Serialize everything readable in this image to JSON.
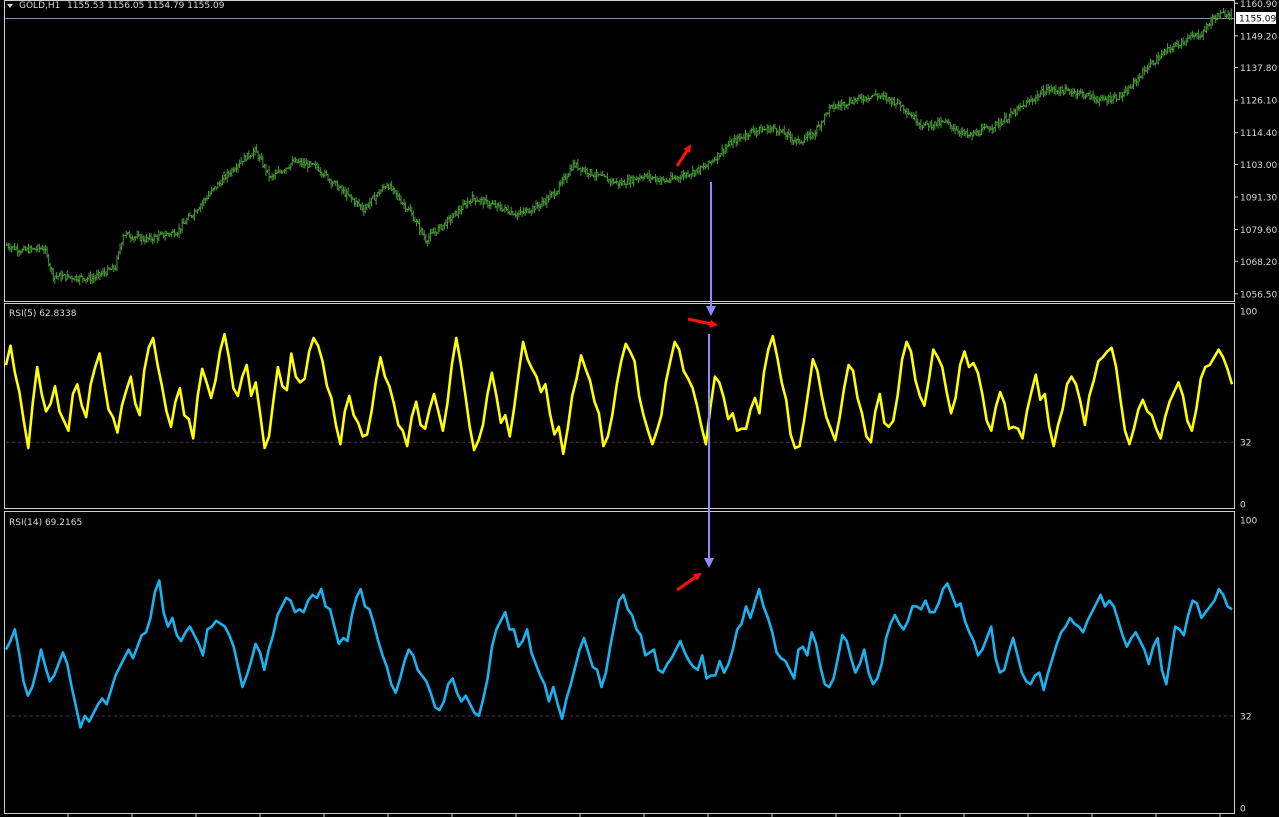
{
  "header": {
    "symbol": "GOLD,H1",
    "ohlc": "1155.53 1156.05 1154.79 1155.09",
    "dropdown_icon": "triangle-down-icon"
  },
  "colors": {
    "background": "#000000",
    "price_bars": "#4a9a3a",
    "rsi5": "#ffff00",
    "rsi14": "#19b4f0",
    "arrows_red": "#ff1010",
    "arrows_blue": "#8a8aff",
    "level_line": "#6a2a6a",
    "grid_frame": "#d0d0d0"
  },
  "chart_data": [
    {
      "type": "bar",
      "name": "price",
      "title": "GOLD,H1",
      "ylim": [
        1055.0,
        1161.0
      ],
      "yticks": [
        "1160.90",
        "1149.20",
        "1137.80",
        "1126.10",
        "1114.40",
        "1103.00",
        "1091.30",
        "1079.60",
        "1068.20",
        "1056.50"
      ],
      "last_price": "1155.09",
      "keypoints": [
        [
          0,
          1074
        ],
        [
          10,
          1072
        ],
        [
          24,
          1073
        ],
        [
          30,
          1063
        ],
        [
          55,
          1062
        ],
        [
          70,
          1066
        ],
        [
          75,
          1078
        ],
        [
          90,
          1076
        ],
        [
          110,
          1079
        ],
        [
          130,
          1092
        ],
        [
          150,
          1104
        ],
        [
          160,
          1108
        ],
        [
          170,
          1098
        ],
        [
          185,
          1104
        ],
        [
          200,
          1102
        ],
        [
          215,
          1094
        ],
        [
          230,
          1087
        ],
        [
          245,
          1096
        ],
        [
          260,
          1086
        ],
        [
          270,
          1076
        ],
        [
          285,
          1083
        ],
        [
          300,
          1091
        ],
        [
          315,
          1088
        ],
        [
          330,
          1085
        ],
        [
          345,
          1089
        ],
        [
          355,
          1094
        ],
        [
          365,
          1103
        ],
        [
          380,
          1099
        ],
        [
          395,
          1096
        ],
        [
          410,
          1099
        ],
        [
          425,
          1097
        ],
        [
          440,
          1100
        ],
        [
          450,
          1102
        ],
        [
          465,
          1110
        ],
        [
          480,
          1115
        ],
        [
          495,
          1116
        ],
        [
          510,
          1111
        ],
        [
          520,
          1114
        ],
        [
          530,
          1123
        ],
        [
          545,
          1126
        ],
        [
          560,
          1128
        ],
        [
          575,
          1125
        ],
        [
          590,
          1117
        ],
        [
          605,
          1118
        ],
        [
          620,
          1113
        ],
        [
          640,
          1118
        ],
        [
          655,
          1124
        ],
        [
          670,
          1130
        ],
        [
          690,
          1129
        ],
        [
          705,
          1126
        ],
        [
          720,
          1128
        ],
        [
          735,
          1138
        ],
        [
          748,
          1144
        ],
        [
          760,
          1148
        ],
        [
          770,
          1150
        ],
        [
          778,
          1156
        ],
        [
          790,
          1158
        ]
      ]
    },
    {
      "type": "line",
      "name": "rsi5",
      "title": "RSI(5) 62.8338",
      "ylim": [
        0,
        100
      ],
      "yticks": [
        "100",
        "32",
        "0"
      ],
      "level": 32,
      "values": [
        72,
        82,
        68,
        58,
        43,
        29,
        52,
        71,
        57,
        48,
        52,
        61,
        48,
        43,
        38,
        57,
        62,
        51,
        45,
        62,
        71,
        78,
        63,
        49,
        45,
        37,
        51,
        59,
        66,
        52,
        46,
        69,
        81,
        86,
        72,
        61,
        48,
        40,
        53,
        60,
        46,
        44,
        34,
        56,
        70,
        63,
        55,
        64,
        79,
        88,
        76,
        60,
        56,
        66,
        72,
        56,
        63,
        47,
        29,
        35,
        54,
        71,
        61,
        59,
        78,
        66,
        63,
        65,
        79,
        86,
        82,
        74,
        61,
        55,
        41,
        31,
        48,
        56,
        46,
        42,
        35,
        36,
        48,
        64,
        76,
        66,
        61,
        52,
        41,
        38,
        30,
        45,
        53,
        41,
        39,
        49,
        57,
        48,
        38,
        52,
        72,
        86,
        73,
        57,
        40,
        28,
        33,
        41,
        57,
        68,
        56,
        42,
        46,
        35,
        50,
        68,
        84,
        75,
        70,
        66,
        58,
        62,
        47,
        36,
        40,
        26,
        39,
        56,
        65,
        77,
        70,
        64,
        53,
        47,
        30,
        35,
        46,
        62,
        74,
        83,
        79,
        74,
        56,
        46,
        38,
        31,
        38,
        46,
        63,
        74,
        84,
        80,
        69,
        65,
        60,
        51,
        40,
        31,
        50,
        66,
        63,
        55,
        44,
        47,
        38,
        39,
        39,
        49,
        55,
        47,
        68,
        80,
        87,
        76,
        63,
        54,
        36,
        29,
        30,
        43,
        59,
        75,
        69,
        56,
        45,
        39,
        33,
        45,
        60,
        72,
        69,
        55,
        47,
        35,
        32,
        48,
        57,
        42,
        40,
        43,
        56,
        75,
        84,
        79,
        64,
        56,
        51,
        64,
        80,
        76,
        71,
        58,
        47,
        55,
        72,
        79,
        71,
        73,
        68,
        57,
        43,
        38,
        50,
        58,
        52,
        39,
        40,
        39,
        34,
        48,
        58,
        67,
        54,
        57,
        40,
        30,
        41,
        49,
        62,
        66,
        62,
        53,
        41,
        56,
        64,
        74,
        76,
        79,
        81,
        71,
        54,
        38,
        31,
        39,
        49,
        54,
        48,
        46,
        39,
        34,
        45,
        53,
        58,
        63,
        56,
        43,
        38,
        49,
        65,
        71,
        72,
        76,
        80,
        76,
        70,
        62
      ],
      "ticks": []
    },
    {
      "type": "line",
      "name": "rsi14",
      "title": "RSI(14) 69.2165",
      "ylim": [
        0,
        100
      ],
      "yticks": [
        "100",
        "32",
        "0"
      ],
      "level": 32,
      "values": [
        55,
        58,
        62,
        54,
        44,
        39,
        42,
        48,
        55,
        49,
        44,
        46,
        50,
        54,
        50,
        42,
        35,
        28,
        32,
        30,
        33,
        36,
        38,
        36,
        41,
        46,
        49,
        52,
        55,
        52,
        56,
        60,
        61,
        66,
        75,
        79,
        68,
        63,
        66,
        60,
        58,
        61,
        63,
        60,
        57,
        53,
        62,
        63,
        65,
        64,
        63,
        60,
        56,
        49,
        42,
        46,
        51,
        57,
        54,
        48,
        55,
        60,
        67,
        70,
        73,
        72,
        68,
        69,
        68,
        72,
        74,
        73,
        76,
        70,
        69,
        63,
        57,
        59,
        58,
        67,
        73,
        76,
        70,
        69,
        64,
        58,
        53,
        49,
        43,
        40,
        45,
        51,
        55,
        53,
        48,
        46,
        44,
        40,
        35,
        34,
        37,
        43,
        45,
        40,
        37,
        39,
        36,
        33,
        32,
        38,
        45,
        56,
        62,
        65,
        68,
        62,
        62,
        56,
        58,
        62,
        54,
        50,
        46,
        43,
        37,
        42,
        36,
        31,
        38,
        43,
        49,
        55,
        59,
        54,
        49,
        48,
        42,
        47,
        56,
        64,
        72,
        74,
        69,
        67,
        62,
        60,
        53,
        54,
        55,
        48,
        47,
        50,
        52,
        55,
        58,
        54,
        51,
        49,
        48,
        53,
        45,
        46,
        46,
        51,
        47,
        50,
        55,
        62,
        64,
        70,
        66,
        71,
        76,
        70,
        66,
        61,
        54,
        52,
        51,
        48,
        45,
        55,
        56,
        53,
        61,
        57,
        49,
        43,
        42,
        45,
        52,
        60,
        58,
        52,
        47,
        50,
        55,
        47,
        43,
        45,
        50,
        59,
        64,
        67,
        64,
        62,
        65,
        70,
        70,
        69,
        72,
        68,
        68,
        71,
        76,
        78,
        74,
        70,
        71,
        65,
        61,
        58,
        53,
        55,
        59,
        63,
        52,
        47,
        48,
        54,
        59,
        53,
        47,
        44,
        43,
        46,
        47,
        41,
        47,
        52,
        57,
        61,
        63,
        66,
        64,
        63,
        61,
        65,
        68,
        71,
        74,
        70,
        72,
        70,
        65,
        60,
        56,
        59,
        61,
        58,
        55,
        50,
        56,
        59,
        48,
        43,
        53,
        63,
        62,
        60,
        67,
        72,
        71,
        66,
        68,
        70,
        72,
        76,
        74,
        70,
        69
      ]
    }
  ],
  "annotations": [
    {
      "name": "red-arrow-price",
      "icon": "arrow-icon"
    },
    {
      "name": "red-arrow-rsi5",
      "icon": "arrow-icon"
    },
    {
      "name": "red-arrow-rsi14",
      "icon": "arrow-icon"
    },
    {
      "name": "blue-arrow-price-to-rsi5",
      "icon": "arrow-icon"
    },
    {
      "name": "blue-arrow-rsi5-to-rsi14",
      "icon": "arrow-icon"
    }
  ]
}
